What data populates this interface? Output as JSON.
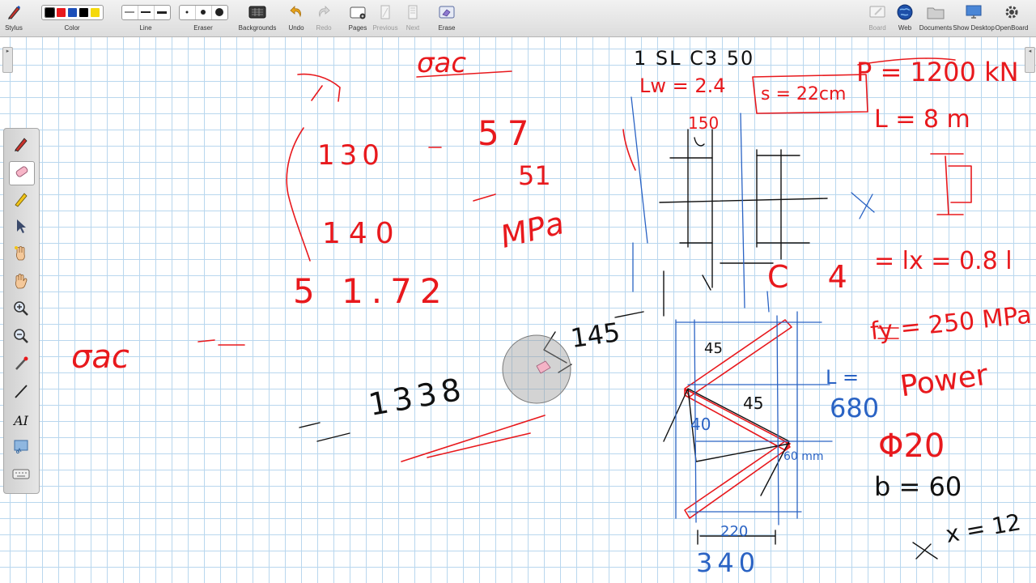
{
  "toolbar": {
    "stylus_label": "Stylus",
    "color_label": "Color",
    "colors": [
      "#000000",
      "#e8191d",
      "#1c4fb8",
      "#000000",
      "#f5d90a"
    ],
    "line_label": "Line",
    "eraser_label": "Eraser",
    "backgrounds_label": "Backgrounds",
    "undo_label": "Undo",
    "redo_label": "Redo",
    "pages_label": "Pages",
    "previous_label": "Previous",
    "next_label": "Next",
    "erase_label": "Erase",
    "board_label": "Board",
    "web_label": "Web",
    "documents_label": "Documents",
    "show_desktop_label": "Show Desktop",
    "openboard_label": "OpenBoard"
  },
  "sidebar": {
    "tools": [
      "pen-icon",
      "eraser-icon",
      "marker-icon",
      "selector-icon",
      "interact-icon",
      "hand-icon",
      "zoom-in-icon",
      "zoom-out-icon",
      "laser-pointer-icon",
      "line-icon",
      "text-icon",
      "capture-icon",
      "keyboard-icon"
    ],
    "active_tool": "eraser-icon",
    "text_tool_glyph": "AI"
  },
  "board": {
    "ink_colors": {
      "red": "#e8191d",
      "black": "#111111",
      "blue": "#2a63c4"
    },
    "text_marks": {
      "sigma_ac_top": "σac",
      "v130": "130",
      "v57": "57",
      "v51": "51",
      "v140": "140",
      "v172": "5 1.72",
      "mpa": "MPa",
      "v145": "145",
      "v1338": "1338",
      "sigma_ac_left": "σac",
      "spec_line": "1 SL C3 50",
      "spec_line2": "Lw = 2.4",
      "spacing": "s = 22cm",
      "load": "P = 1200 kN",
      "length": "L = 8 m",
      "s150": "150",
      "c4": "C 4",
      "lx_eq": "= lx = 0.8 l",
      "fy": "fy = 250 MPa",
      "power": "Power",
      "phi20": "Φ20",
      "lprime": "L =",
      "v680": "680",
      "a45": "45",
      "a45b": "45",
      "a40": "40",
      "d220": "220",
      "d340": "340",
      "v60": "60",
      "b60": "b = 60",
      "x12": "x = 12",
      "x_axis": "X",
      "v60mm": "60 mm"
    }
  }
}
